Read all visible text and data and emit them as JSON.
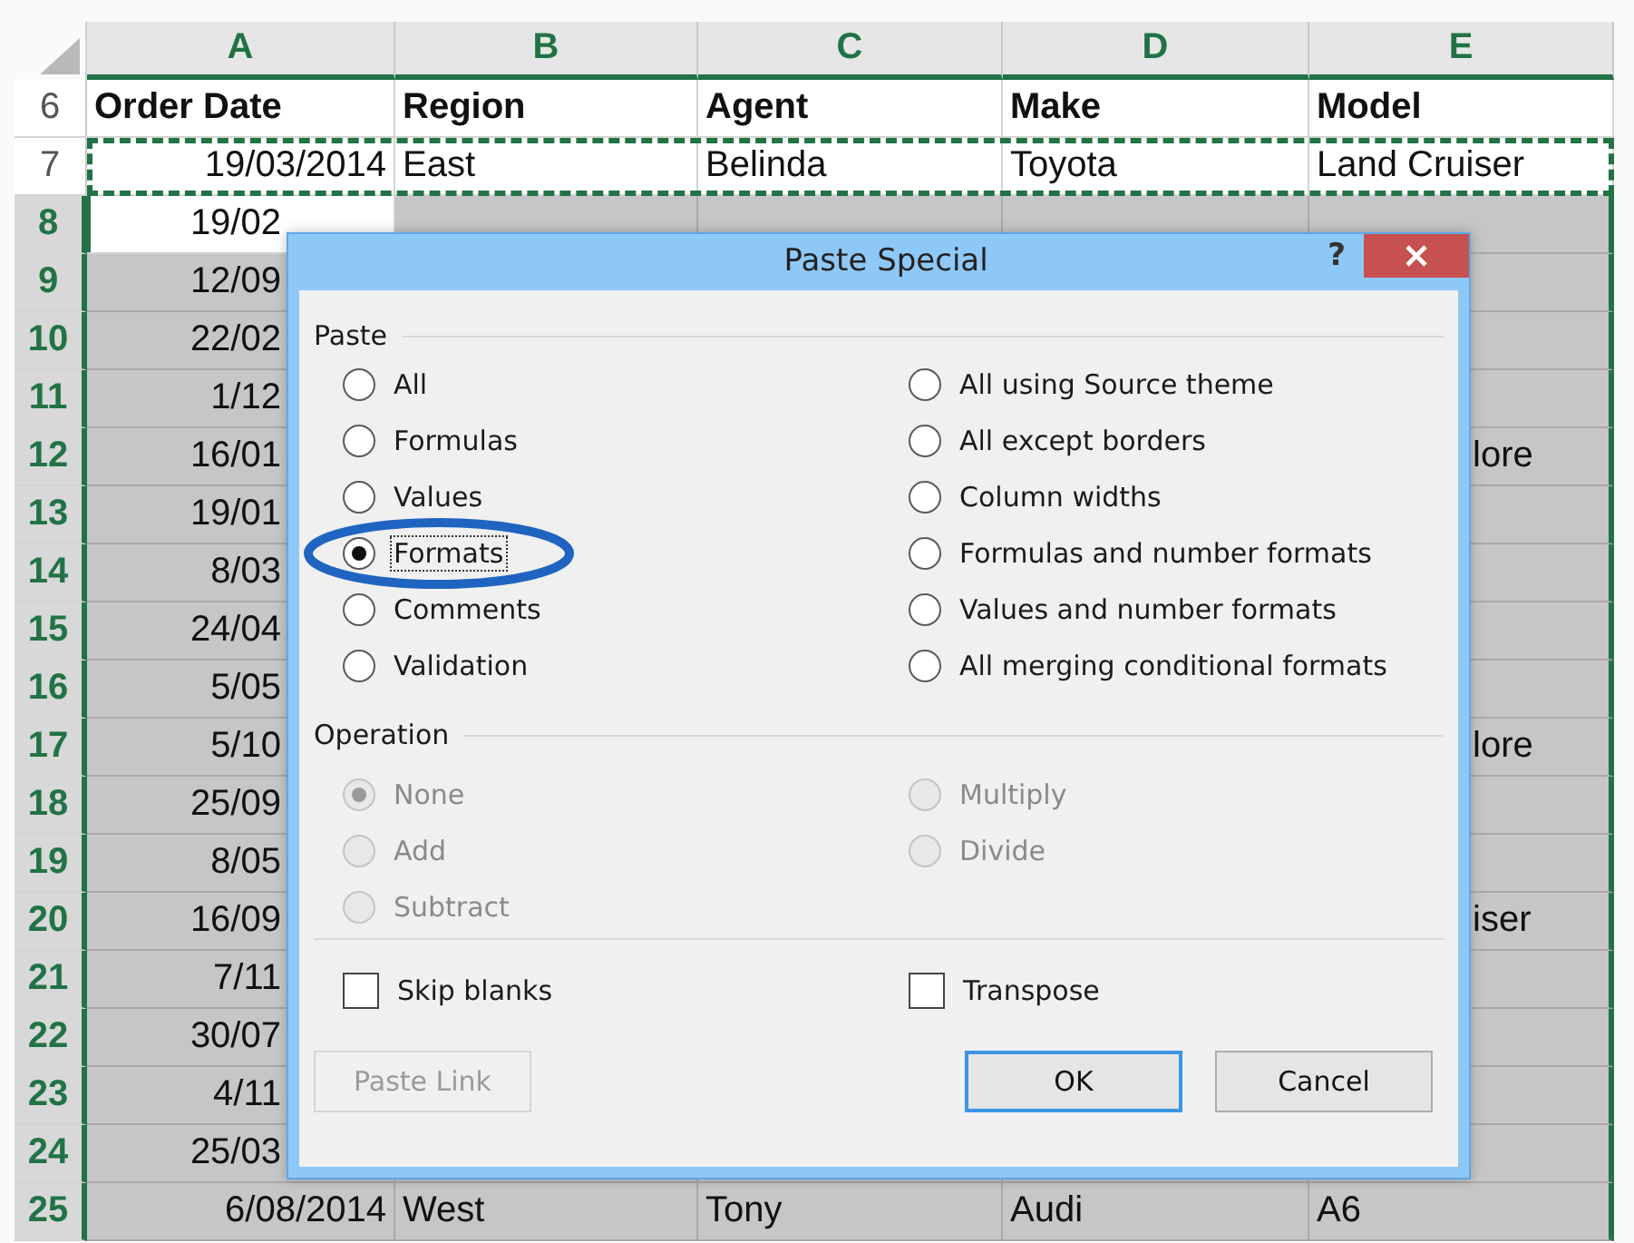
{
  "sheet": {
    "columns": [
      {
        "label": "A",
        "selected": true
      },
      {
        "label": "B",
        "selected": true
      },
      {
        "label": "C",
        "selected": true
      },
      {
        "label": "D",
        "selected": true
      },
      {
        "label": "E",
        "selected": true
      }
    ],
    "rows": [
      {
        "number": "6",
        "kind": "header",
        "selected": false,
        "copied": false,
        "active": false,
        "cells": [
          "Order Date",
          "Region",
          "Agent",
          "Make",
          "Model"
        ]
      },
      {
        "number": "7",
        "kind": "data",
        "selected": false,
        "copied": true,
        "active": false,
        "cells": [
          "19/03/2014",
          "East",
          "Belinda",
          "Toyota",
          "Land Cruiser"
        ]
      },
      {
        "number": "8",
        "kind": "partial",
        "selected": true,
        "copied": false,
        "active": true,
        "cells": [
          "19/02",
          null,
          null,
          null,
          null
        ]
      },
      {
        "number": "9",
        "kind": "partial",
        "selected": true,
        "copied": false,
        "active": false,
        "cells": [
          "12/09",
          null,
          null,
          null,
          null
        ]
      },
      {
        "number": "10",
        "kind": "partial",
        "selected": true,
        "copied": false,
        "active": false,
        "cells": [
          "22/02",
          null,
          null,
          null,
          null
        ]
      },
      {
        "number": "11",
        "kind": "partial",
        "selected": true,
        "copied": false,
        "active": false,
        "cells": [
          "1/12",
          null,
          null,
          null,
          null
        ]
      },
      {
        "number": "12",
        "kind": "partial",
        "selected": true,
        "copied": false,
        "active": false,
        "cells": [
          "16/01",
          null,
          null,
          null,
          "lore"
        ]
      },
      {
        "number": "13",
        "kind": "partial",
        "selected": true,
        "copied": false,
        "active": false,
        "cells": [
          "19/01",
          null,
          null,
          null,
          null
        ]
      },
      {
        "number": "14",
        "kind": "partial",
        "selected": true,
        "copied": false,
        "active": false,
        "cells": [
          "8/03",
          null,
          null,
          null,
          null
        ]
      },
      {
        "number": "15",
        "kind": "partial",
        "selected": true,
        "copied": false,
        "active": false,
        "cells": [
          "24/04",
          null,
          null,
          null,
          null
        ]
      },
      {
        "number": "16",
        "kind": "partial",
        "selected": true,
        "copied": false,
        "active": false,
        "cells": [
          "5/05",
          null,
          null,
          null,
          null
        ]
      },
      {
        "number": "17",
        "kind": "partial",
        "selected": true,
        "copied": false,
        "active": false,
        "cells": [
          "5/10",
          null,
          null,
          null,
          "lore"
        ]
      },
      {
        "number": "18",
        "kind": "partial",
        "selected": true,
        "copied": false,
        "active": false,
        "cells": [
          "25/09",
          null,
          null,
          null,
          null
        ]
      },
      {
        "number": "19",
        "kind": "partial",
        "selected": true,
        "copied": false,
        "active": false,
        "cells": [
          "8/05",
          null,
          null,
          null,
          null
        ]
      },
      {
        "number": "20",
        "kind": "partial",
        "selected": true,
        "copied": false,
        "active": false,
        "cells": [
          "16/09",
          null,
          null,
          null,
          "iser"
        ]
      },
      {
        "number": "21",
        "kind": "partial",
        "selected": true,
        "copied": false,
        "active": false,
        "cells": [
          "7/11",
          null,
          null,
          null,
          null
        ]
      },
      {
        "number": "22",
        "kind": "partial",
        "selected": true,
        "copied": false,
        "active": false,
        "cells": [
          "30/07",
          null,
          null,
          null,
          null
        ]
      },
      {
        "number": "23",
        "kind": "partial",
        "selected": true,
        "copied": false,
        "active": false,
        "cells": [
          "4/11",
          null,
          null,
          null,
          null
        ]
      },
      {
        "number": "24",
        "kind": "partial",
        "selected": true,
        "copied": false,
        "active": false,
        "cells": [
          "25/03",
          null,
          null,
          null,
          null
        ]
      },
      {
        "number": "25",
        "kind": "data",
        "selected": true,
        "copied": false,
        "active": false,
        "cells": [
          "6/08/2014",
          "West",
          "Tony",
          "Audi",
          "A6"
        ]
      }
    ]
  },
  "dialog": {
    "title": "Paste Special",
    "help": "?",
    "paste": {
      "label": "Paste",
      "options": [
        {
          "label": "All",
          "selected": false,
          "focused": false,
          "highlighted": false,
          "disabled": false
        },
        {
          "label": "All using Source theme",
          "selected": false,
          "focused": false,
          "highlighted": false,
          "disabled": false
        },
        {
          "label": "Formulas",
          "selected": false,
          "focused": false,
          "highlighted": false,
          "disabled": false
        },
        {
          "label": "All except borders",
          "selected": false,
          "focused": false,
          "highlighted": false,
          "disabled": false
        },
        {
          "label": "Values",
          "selected": false,
          "focused": false,
          "highlighted": false,
          "disabled": false
        },
        {
          "label": "Column widths",
          "selected": false,
          "focused": false,
          "highlighted": false,
          "disabled": false
        },
        {
          "label": "Formats",
          "selected": true,
          "focused": true,
          "highlighted": true,
          "disabled": false
        },
        {
          "label": "Formulas and number formats",
          "selected": false,
          "focused": false,
          "highlighted": false,
          "disabled": false
        },
        {
          "label": "Comments",
          "selected": false,
          "focused": false,
          "highlighted": false,
          "disabled": false
        },
        {
          "label": "Values and number formats",
          "selected": false,
          "focused": false,
          "highlighted": false,
          "disabled": false
        },
        {
          "label": "Validation",
          "selected": false,
          "focused": false,
          "highlighted": false,
          "disabled": false
        },
        {
          "label": "All merging conditional formats",
          "selected": false,
          "focused": false,
          "highlighted": false,
          "disabled": false
        }
      ]
    },
    "operation": {
      "label": "Operation",
      "options": [
        {
          "label": "None",
          "selected": true,
          "disabled": true
        },
        {
          "label": "Multiply",
          "selected": false,
          "disabled": true
        },
        {
          "label": "Add",
          "selected": false,
          "disabled": true
        },
        {
          "label": "Divide",
          "selected": false,
          "disabled": true
        },
        {
          "label": "Subtract",
          "selected": false,
          "disabled": true
        }
      ]
    },
    "checkboxes": [
      {
        "label": "Skip blanks",
        "checked": false
      },
      {
        "label": "Transpose",
        "checked": false
      }
    ],
    "buttons": [
      {
        "label": "Paste Link",
        "disabled": true,
        "default": false
      },
      {
        "label": "OK",
        "disabled": false,
        "default": true
      },
      {
        "label": "Cancel",
        "disabled": false,
        "default": false
      }
    ]
  }
}
